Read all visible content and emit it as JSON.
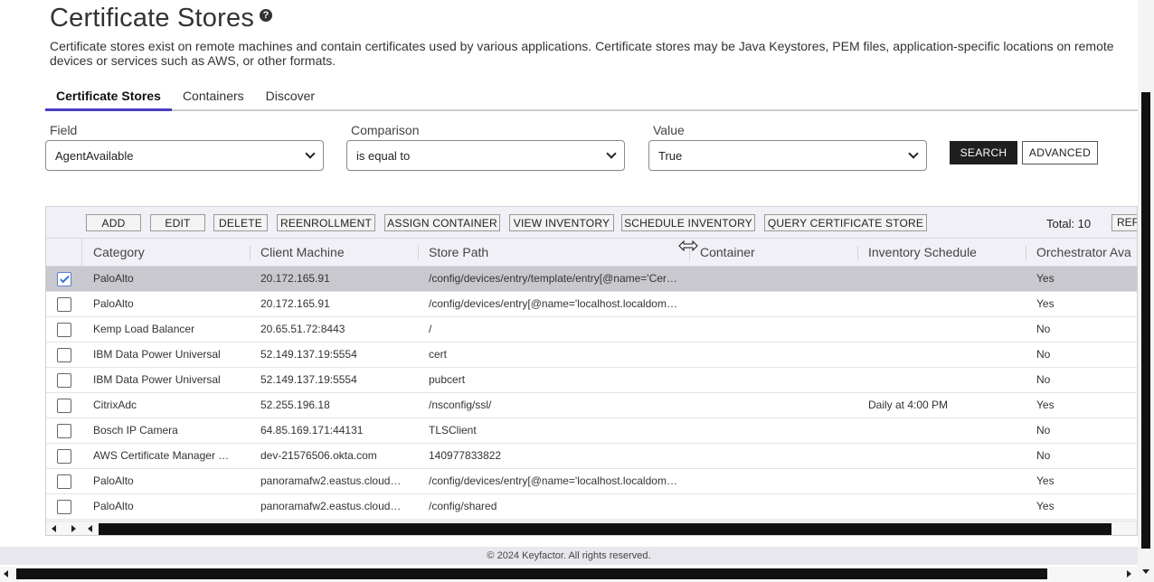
{
  "page": {
    "title": "Certificate Stores",
    "help_icon": "question-icon",
    "description": "Certificate stores exist on remote machines and contain certificates used by various applications. Certificate stores may be Java Keystores, PEM files, application-specific locations on remote devices or services such as AWS, or other formats."
  },
  "tabs": [
    {
      "label": "Certificate Stores",
      "active": true
    },
    {
      "label": "Containers",
      "active": false
    },
    {
      "label": "Discover",
      "active": false
    }
  ],
  "filters": {
    "field": {
      "label": "Field",
      "value": "AgentAvailable"
    },
    "comparison": {
      "label": "Comparison",
      "value": "is equal to"
    },
    "value": {
      "label": "Value",
      "value": "True"
    },
    "search_label": "SEARCH",
    "advanced_label": "ADVANCED"
  },
  "toolbar": {
    "buttons": [
      "ADD",
      "EDIT",
      "DELETE",
      "REENROLLMENT",
      "ASSIGN CONTAINER",
      "VIEW INVENTORY",
      "SCHEDULE INVENTORY",
      "QUERY CERTIFICATE STORE"
    ],
    "total": "Total: 10",
    "refresh_label": "REF"
  },
  "table": {
    "columns": [
      "Category",
      "Client Machine",
      "Store Path",
      "Container",
      "Inventory Schedule",
      "Orchestrator Ava"
    ],
    "rows": [
      {
        "selected": true,
        "category": "PaloAlto",
        "client": "20.172.165.91",
        "path": "/config/devices/entry/template/entry[@name='Cer…",
        "container": "",
        "schedule": "",
        "orch": "Yes"
      },
      {
        "selected": false,
        "category": "PaloAlto",
        "client": "20.172.165.91",
        "path": "/config/devices/entry[@name='localhost.localdom…",
        "container": "",
        "schedule": "",
        "orch": "Yes"
      },
      {
        "selected": false,
        "category": "Kemp Load Balancer",
        "client": "20.65.51.72:8443",
        "path": "/",
        "container": "",
        "schedule": "",
        "orch": "No"
      },
      {
        "selected": false,
        "category": "IBM Data Power Universal",
        "client": "52.149.137.19:5554",
        "path": "cert",
        "container": "",
        "schedule": "",
        "orch": "No"
      },
      {
        "selected": false,
        "category": "IBM Data Power Universal",
        "client": "52.149.137.19:5554",
        "path": "pubcert",
        "container": "",
        "schedule": "",
        "orch": "No"
      },
      {
        "selected": false,
        "category": "CitrixAdc",
        "client": "52.255.196.18",
        "path": "/nsconfig/ssl/",
        "container": "",
        "schedule": "Daily at 4:00 PM",
        "orch": "Yes"
      },
      {
        "selected": false,
        "category": "Bosch IP Camera",
        "client": "64.85.169.171:44131",
        "path": "TLSClient",
        "container": "",
        "schedule": "",
        "orch": "No"
      },
      {
        "selected": false,
        "category": "AWS Certificate Manager …",
        "client": "dev-21576506.okta.com",
        "path": "140977833822",
        "container": "",
        "schedule": "",
        "orch": "No"
      },
      {
        "selected": false,
        "category": "PaloAlto",
        "client": "panoramafw2.eastus.cloud…",
        "path": "/config/devices/entry[@name='localhost.localdom…",
        "container": "",
        "schedule": "",
        "orch": "Yes"
      },
      {
        "selected": false,
        "category": "PaloAlto",
        "client": "panoramafw2.eastus.cloud…",
        "path": "/config/shared",
        "container": "",
        "schedule": "",
        "orch": "Yes"
      }
    ]
  },
  "footer": {
    "text": "© 2024 Keyfactor. All rights reserved."
  },
  "colors": {
    "accent": "#4b3fc0",
    "selected_row": "#c9c8ce",
    "header_bg": "#f1f0f7"
  }
}
